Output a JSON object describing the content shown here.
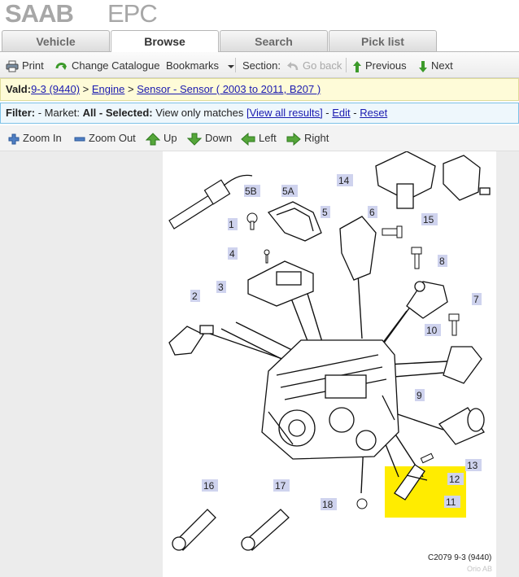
{
  "logo": {
    "brand": "SAAB",
    "product": "EPC"
  },
  "tabs": [
    {
      "label": "Vehicle"
    },
    {
      "label": "Browse"
    },
    {
      "label": "Search"
    },
    {
      "label": "Pick list"
    }
  ],
  "toolbar": {
    "print": "Print",
    "change_catalogue": "Change Catalogue",
    "bookmarks": "Bookmarks",
    "section": "Section:",
    "go_back": "Go back",
    "previous": "Previous",
    "next": "Next"
  },
  "breadcrumb": {
    "prefix": "Vald:",
    "model": "9-3 (9440)",
    "sep": " > ",
    "group": "Engine",
    "sub": "Sensor - Sensor ( 2003 to 2011, B207 )"
  },
  "filter": {
    "label": "Filter:",
    "market_label": " - Market: ",
    "market_value": "All",
    "selected_label": " - Selected: ",
    "selected_value": "View only matches ",
    "view_all": "[View all results]",
    "sep1": " - ",
    "edit": "Edit",
    "sep2": " - ",
    "reset": "Reset"
  },
  "zoom": {
    "zoom_in": "Zoom In",
    "zoom_out": "Zoom Out",
    "up": "Up",
    "down": "Down",
    "left": "Left",
    "right": "Right"
  },
  "diagram": {
    "callouts": [
      "1",
      "5B",
      "5A",
      "5",
      "6",
      "14",
      "15",
      "4",
      "8",
      "3",
      "2",
      "7",
      "10",
      "9",
      "13",
      "12",
      "11",
      "16",
      "17",
      "18"
    ],
    "caption": "C2079 9-3 (9440)",
    "watermark": "Orio AB",
    "highlight_color": "#ffec00",
    "callout_box_color": "#cfd3ee"
  },
  "colors": {
    "link": "#1a1ab0",
    "breadcrumb_bg": "#fefbd8",
    "filter_bg": "#eef7fc",
    "icon_green": "#3c9a2a"
  }
}
